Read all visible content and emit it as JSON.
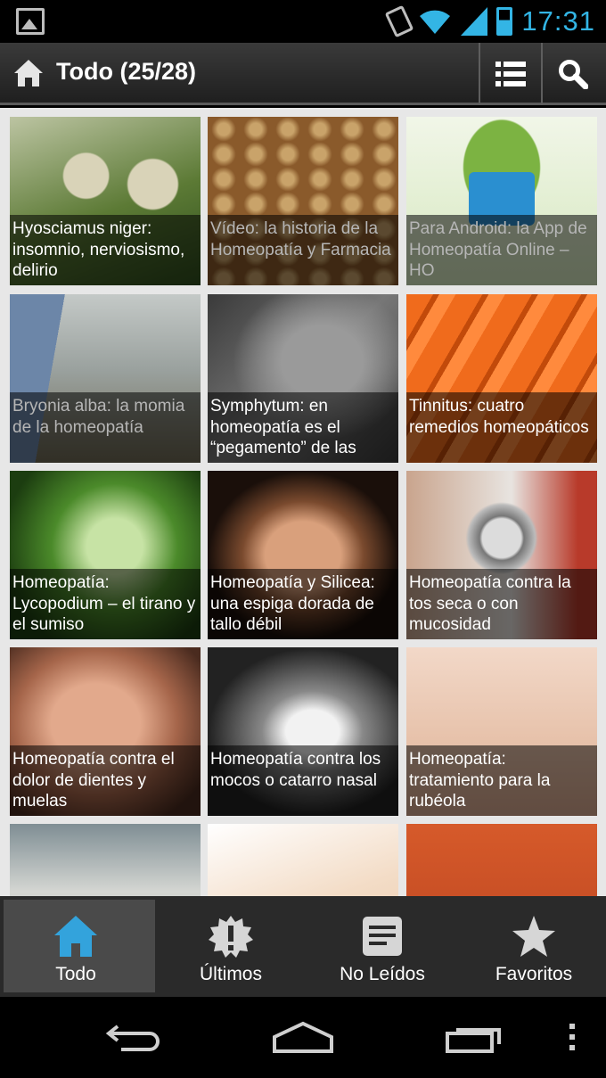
{
  "status_bar": {
    "time": "17:31",
    "icons": [
      "gallery-notification-icon",
      "vibrate-icon",
      "wifi-icon",
      "signal-icon",
      "battery-icon"
    ],
    "accent": "#33b5e5"
  },
  "action_bar": {
    "title": "Todo (25/28)",
    "icons": [
      "home-icon",
      "list-icon",
      "search-icon"
    ]
  },
  "articles": [
    {
      "title": "Hyosciamus niger: insomnio, nerviosismo, delirio",
      "read": false
    },
    {
      "title": "Vídeo: la historia de la Homeopatía y Farmacia",
      "read": true
    },
    {
      "title": "Para Android: la App de Homeopatía Online – HO",
      "read": true
    },
    {
      "title": "Bryonia alba: la momia de la homeopatía",
      "read": true
    },
    {
      "title": "Symphytum: en homeopatía es el “pegamento” de las",
      "read": false
    },
    {
      "title": "Tinnitus: cuatro remedios homeopáticos",
      "read": false
    },
    {
      "title": "Homeopatía: Lycopodium – el tirano y el sumiso",
      "read": false
    },
    {
      "title": "Homeopatía y Silicea: una espiga dorada de tallo débil",
      "read": false
    },
    {
      "title": "Homeopatía contra la tos seca o con mucosidad",
      "read": false
    },
    {
      "title": "Homeopatía contra el dolor de dientes y muelas",
      "read": false
    },
    {
      "title": "Homeopatía contra los mocos o catarro nasal",
      "read": false
    },
    {
      "title": "Homeopatía: tratamiento para la rubéola",
      "read": false
    },
    {
      "title": "",
      "read": false
    },
    {
      "title": "",
      "read": false
    },
    {
      "title": "",
      "read": false
    }
  ],
  "tabs": [
    {
      "label": "Todo",
      "icon": "home-icon",
      "active": true
    },
    {
      "label": "Últimos",
      "icon": "new-badge-icon",
      "active": false
    },
    {
      "label": "No Leídos",
      "icon": "unread-document-icon",
      "active": false
    },
    {
      "label": "Favoritos",
      "icon": "star-icon",
      "active": false
    }
  ],
  "nav_bar": {
    "icons": [
      "back-icon",
      "home-nav-icon",
      "recent-apps-icon",
      "menu-overflow-icon"
    ]
  }
}
